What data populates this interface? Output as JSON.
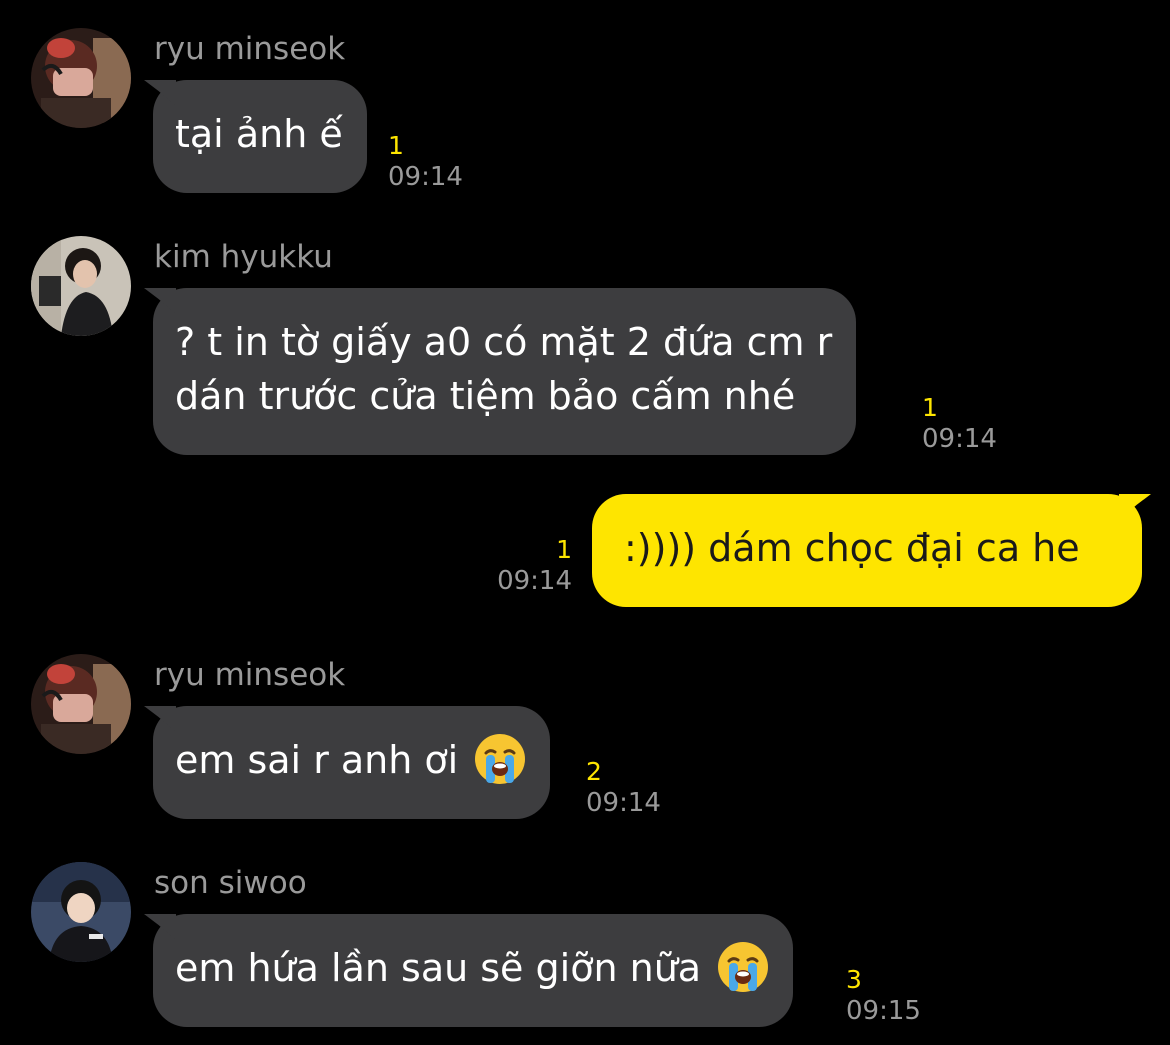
{
  "messages": [
    {
      "sender": "ryu minseok",
      "avatar": "ryu-minseok-avatar",
      "lines": [
        "tại ảnh ế"
      ],
      "emoji": "",
      "unread": "1",
      "time": "09:14",
      "direction": "incoming"
    },
    {
      "sender": "kim hyukku",
      "avatar": "kim-hyukku-avatar",
      "lines": [
        "? t in tờ giấy a0 có mặt 2 đứa cm r",
        "dán trước cửa tiệm bảo cấm nhé"
      ],
      "emoji": "",
      "unread": "1",
      "time": "09:14",
      "direction": "incoming"
    },
    {
      "sender": "",
      "avatar": "",
      "lines": [
        ":)))) dám chọc đại ca he"
      ],
      "emoji": "",
      "unread": "1",
      "time": "09:14",
      "direction": "outgoing"
    },
    {
      "sender": "ryu minseok",
      "avatar": "ryu-minseok-avatar",
      "lines": [
        "em sai r anh ơi"
      ],
      "emoji": "loudly-crying-face-emoji",
      "unread": "2",
      "time": "09:14",
      "direction": "incoming"
    },
    {
      "sender": "son siwoo",
      "avatar": "son-siwoo-avatar",
      "lines": [
        "em hứa lần sau sẽ giỡn nữa"
      ],
      "emoji": "loudly-crying-face-emoji",
      "unread": "3",
      "time": "09:15",
      "direction": "incoming"
    }
  ],
  "colors": {
    "background": "#000000",
    "incoming_bubble": "#3d3d3f",
    "outgoing_bubble": "#fee500",
    "unread_count": "#fee500",
    "meta_text": "#9a9a9a"
  }
}
